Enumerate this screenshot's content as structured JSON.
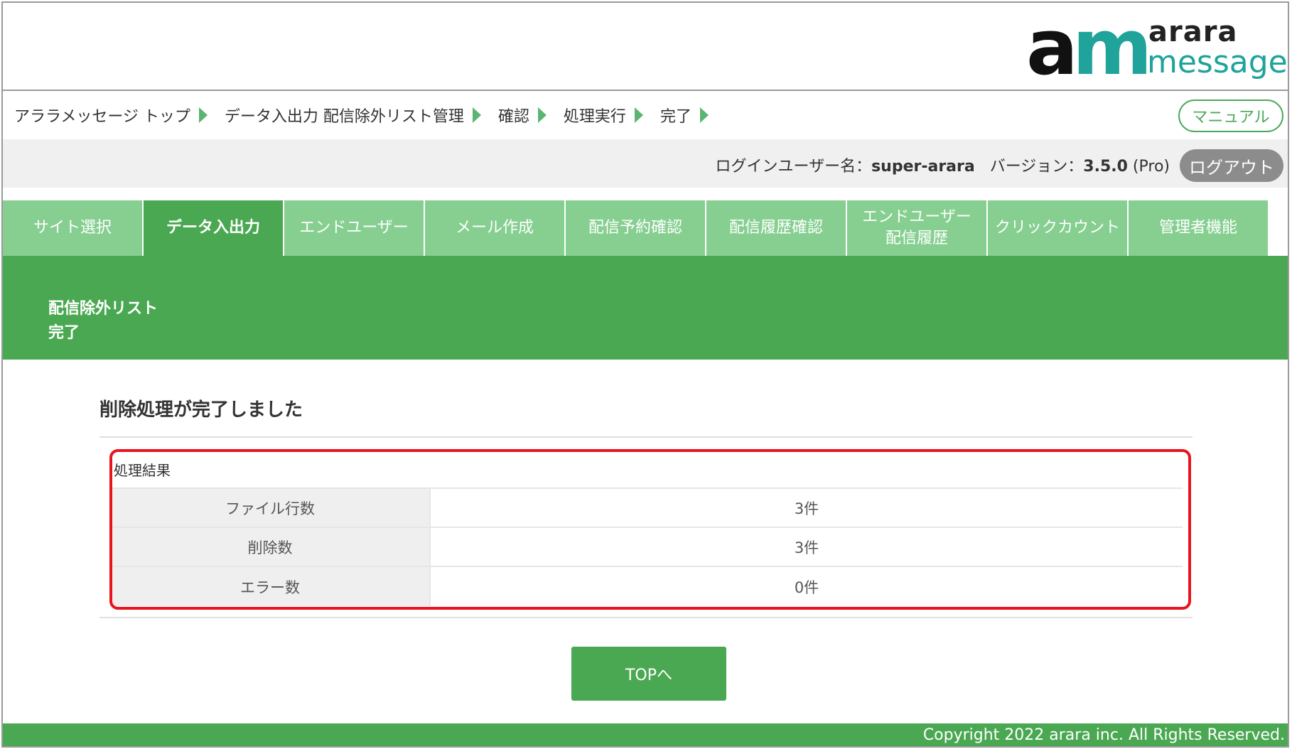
{
  "logo": {
    "mark_a": "a",
    "mark_m": "m",
    "line1": "arara",
    "line2": "message"
  },
  "breadcrumb": {
    "items": [
      "アララメッセージ トップ",
      "データ入出力 配信除外リスト管理",
      "確認",
      "処理実行",
      "完了"
    ]
  },
  "header": {
    "manual_label": "マニュアル"
  },
  "userbar": {
    "user_label": "ログインユーザー名：",
    "user_name": "super-arara",
    "version_label": "バージョン：",
    "version": "3.5.0",
    "edition": "(Pro)",
    "logout_label": "ログアウト"
  },
  "tabs": [
    {
      "line1": "サイト選択",
      "line2": "",
      "active": false
    },
    {
      "line1": "データ入出力",
      "line2": "",
      "active": true
    },
    {
      "line1": "エンドユーザー",
      "line2": "",
      "active": false
    },
    {
      "line1": "メール作成",
      "line2": "",
      "active": false
    },
    {
      "line1": "配信予約確認",
      "line2": "",
      "active": false
    },
    {
      "line1": "配信履歴確認",
      "line2": "",
      "active": false
    },
    {
      "line1": "エンドユーザー",
      "line2": "配信履歴",
      "active": false
    },
    {
      "line1": "クリックカウント",
      "line2": "",
      "active": false
    },
    {
      "line1": "管理者機能",
      "line2": "",
      "active": false
    }
  ],
  "banner": {
    "line1": "配信除外リスト",
    "line2": "完了"
  },
  "main": {
    "heading": "削除処理が完了しました",
    "results_caption": "処理結果",
    "rows": [
      {
        "label": "ファイル行数",
        "value": "3件"
      },
      {
        "label": "削除数",
        "value": "3件"
      },
      {
        "label": "エラー数",
        "value": "0件"
      }
    ],
    "top_button": "TOPへ"
  },
  "footer": {
    "copyright": "Copyright 2022 arara inc. All Rights Reserved."
  },
  "colors": {
    "accent": "#4aa852",
    "tab": "#86cf90",
    "brand_teal": "#1fa39a",
    "highlight": "#e8141e"
  }
}
